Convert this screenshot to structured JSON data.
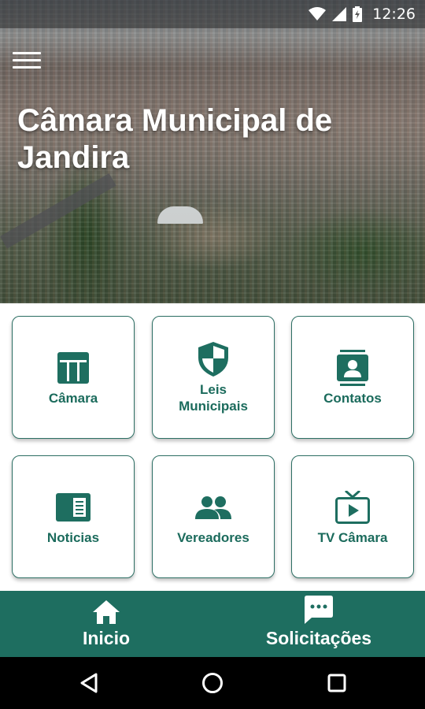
{
  "status_bar": {
    "time": "12:26",
    "icons": [
      "wifi-icon",
      "signal-icon",
      "battery-icon"
    ]
  },
  "header": {
    "title": "Câmara Municipal de Jandira",
    "menu_icon": "menu-icon"
  },
  "grid": {
    "items": [
      {
        "label": "Câmara",
        "icon": "building-icon"
      },
      {
        "label": "Leis Municipais",
        "icon": "shield-icon"
      },
      {
        "label": "Contatos",
        "icon": "contacts-icon"
      },
      {
        "label": "Noticias",
        "icon": "news-icon"
      },
      {
        "label": "Vereadores",
        "icon": "people-icon"
      },
      {
        "label": "TV Câmara",
        "icon": "tv-icon"
      }
    ]
  },
  "bottom_nav": {
    "items": [
      {
        "label": "Inicio",
        "icon": "home-icon"
      },
      {
        "label": "Solicitações",
        "icon": "chat-icon"
      }
    ]
  },
  "system_nav": {
    "icons": [
      "back-icon",
      "home-circle-icon",
      "recents-icon"
    ]
  },
  "colors": {
    "primary": "#1e6e60",
    "text_primary": "#1b6b5c",
    "card_border": "#2d6f64"
  }
}
